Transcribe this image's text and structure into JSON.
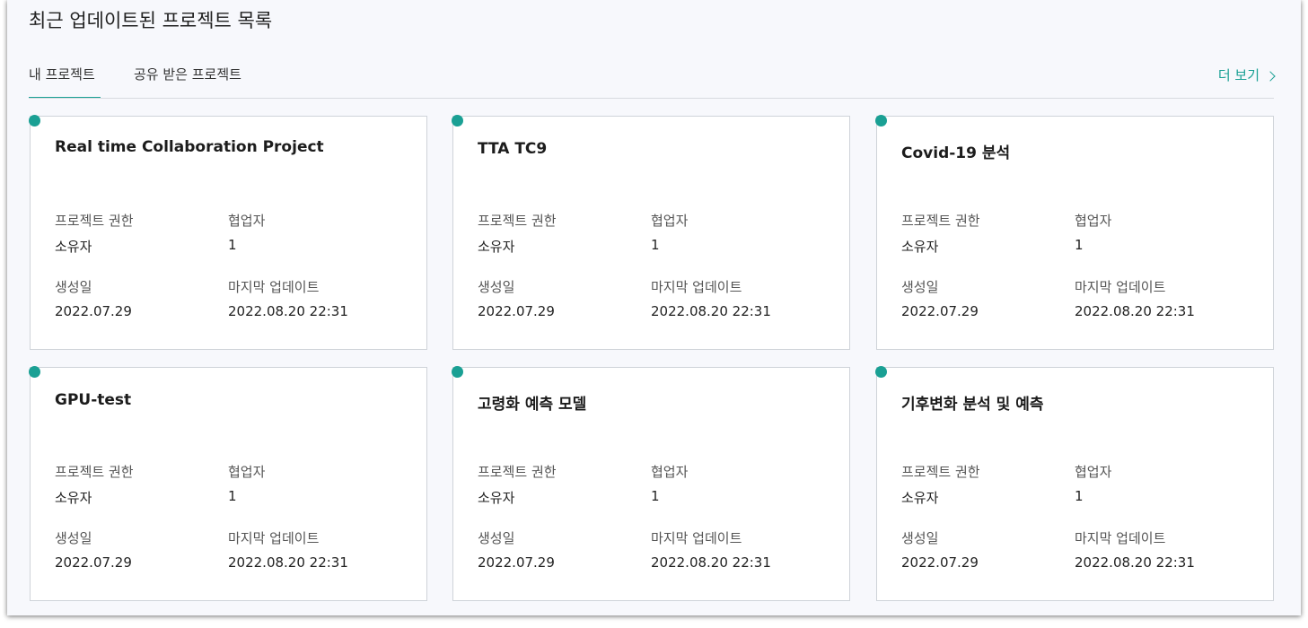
{
  "section": {
    "title": "최근 업데이트된 프로젝트 목록",
    "tabs": [
      {
        "label": "내 프로젝트",
        "active": true
      },
      {
        "label": "공유 받은 프로젝트",
        "active": false
      }
    ],
    "more_label": "더 보기"
  },
  "field_labels": {
    "permission": "프로젝트 권한",
    "collaborators": "협업자",
    "created": "생성일",
    "last_update": "마지막 업데이트"
  },
  "projects": [
    {
      "title": "Real time Collaboration Project",
      "permission": "소유자",
      "collaborators": "1",
      "created": "2022.07.29",
      "last_update": "2022.08.20 22:31"
    },
    {
      "title": "TTA TC9",
      "permission": "소유자",
      "collaborators": "1",
      "created": "2022.07.29",
      "last_update": "2022.08.20 22:31"
    },
    {
      "title": "Covid-19 분석",
      "permission": "소유자",
      "collaborators": "1",
      "created": "2022.07.29",
      "last_update": "2022.08.20 22:31"
    },
    {
      "title": "GPU-test",
      "permission": "소유자",
      "collaborators": "1",
      "created": "2022.07.29",
      "last_update": "2022.08.20 22:31"
    },
    {
      "title": "고령화 예측 모델",
      "permission": "소유자",
      "collaborators": "1",
      "created": "2022.07.29",
      "last_update": "2022.08.20 22:31"
    },
    {
      "title": "기후변화 분석 및 예측",
      "permission": "소유자",
      "collaborators": "1",
      "created": "2022.07.29",
      "last_update": "2022.08.20 22:31"
    }
  ],
  "colors": {
    "accent": "#1aa094",
    "card_border": "#cfd3d9",
    "panel_bg": "#f7f8fc"
  },
  "icons": {
    "more": "chevron-right-icon",
    "status": "status-dot-icon"
  }
}
